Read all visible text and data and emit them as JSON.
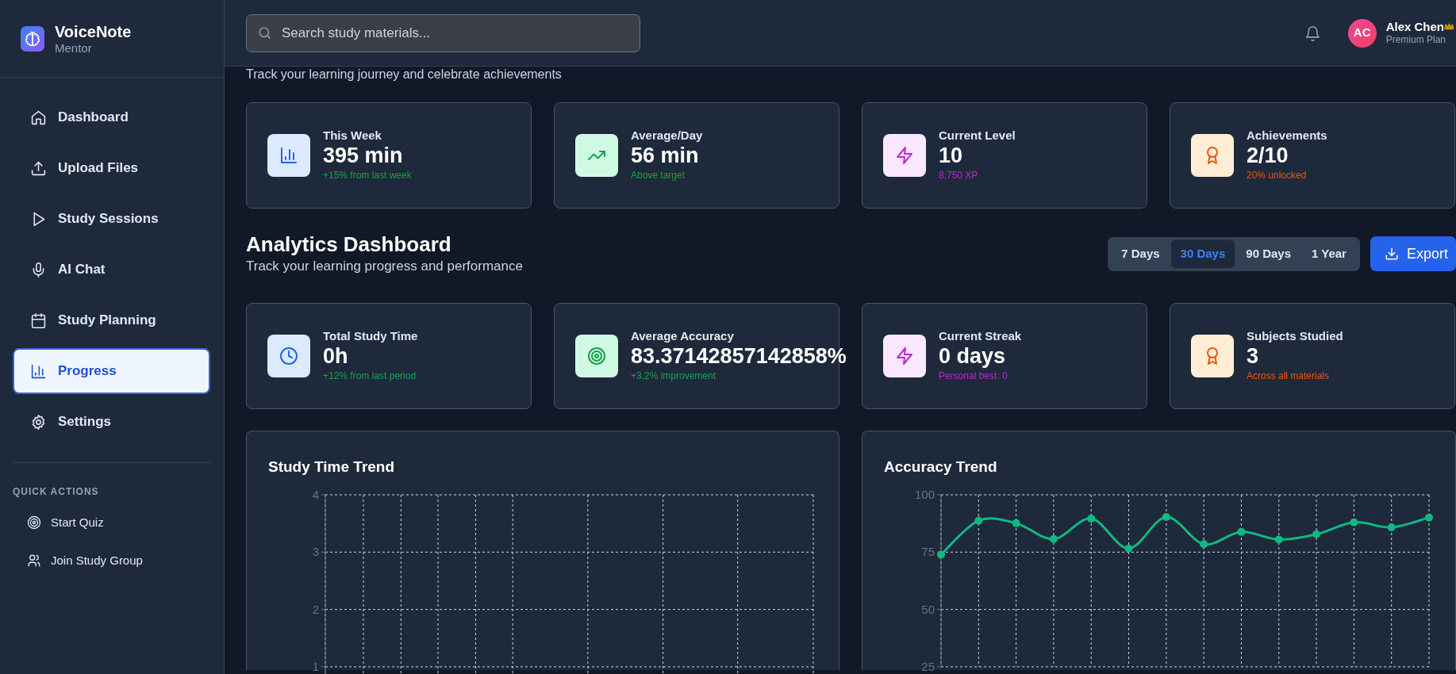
{
  "sidebar": {
    "brand": {
      "name": "VoiceNote",
      "tagline": "Mentor"
    },
    "nav": [
      {
        "label": "Dashboard",
        "selected": false
      },
      {
        "label": "Upload Files",
        "selected": false
      },
      {
        "label": "Study Sessions",
        "selected": false
      },
      {
        "label": "AI Chat",
        "selected": false
      },
      {
        "label": "Study Planning",
        "selected": false
      },
      {
        "label": "Progress",
        "selected": true
      },
      {
        "label": "Settings",
        "selected": false
      }
    ],
    "quick_actions": {
      "heading": "QUICK ACTIONS",
      "items": [
        {
          "label": "Start Quiz"
        },
        {
          "label": "Join Study Group"
        }
      ]
    }
  },
  "header": {
    "search": {
      "placeholder": "Search study materials..."
    },
    "user": {
      "initials": "AC",
      "name": "Alex Chen",
      "premium": true,
      "plan": "Premium Plan"
    }
  },
  "progress": {
    "subtitle": "Track your learning journey and celebrate achievements",
    "stats": [
      {
        "label": "This Week",
        "value": "395 min",
        "note": "+15% from last week",
        "color": "#2563eb"
      },
      {
        "label": "Average/Day",
        "value": "56 min",
        "note": "Above target",
        "color": "#16a34a"
      },
      {
        "label": "Current Level",
        "value": "10",
        "note": "8,750 XP",
        "color": "#c026d3"
      },
      {
        "label": "Achievements",
        "value": "2/10",
        "note": "20% unlocked",
        "color": "#ea580c"
      }
    ]
  },
  "analytics": {
    "title": "Analytics Dashboard",
    "subtitle": "Track your learning progress and performance",
    "ranges": [
      {
        "label": "7 Days",
        "selected": false
      },
      {
        "label": "30 Days",
        "selected": true
      },
      {
        "label": "90 Days",
        "selected": false
      },
      {
        "label": "1 Year",
        "selected": false
      }
    ],
    "export_button": "Export",
    "stats": [
      {
        "label": "Total Study Time",
        "value": "0h",
        "note": "+12% from last period",
        "color": "#2563eb"
      },
      {
        "label": "Average Accuracy",
        "value": "83.37142857142858%",
        "note": "+3.2% improvement",
        "color": "#16a34a"
      },
      {
        "label": "Current Streak",
        "value": "0 days",
        "note": "Personal best: 0",
        "color": "#c026d3"
      },
      {
        "label": "Subjects Studied",
        "value": "3",
        "note": "Across all materials",
        "color": "#ea580c"
      }
    ],
    "charts": [
      {
        "title": "Study Time Trend",
        "y_axis_labels": [
          "4",
          "3",
          "2",
          "1"
        ]
      },
      {
        "chart_data": {
          "type": "line",
          "title": "Accuracy Trend",
          "ylim": [
            25,
            100
          ],
          "yticks": [
            25,
            50,
            75,
            100
          ],
          "grid": true,
          "series": [
            {
              "color": "#10b981",
              "marker": "circle",
              "values": [
                73.9,
                88.7,
                87.6,
                80.7,
                89.6,
                76.6,
                90.3,
                78.5,
                83.8,
                80.5,
                82.8,
                88.0,
                85.8,
                90.1
              ]
            }
          ]
        }
      }
    ]
  }
}
